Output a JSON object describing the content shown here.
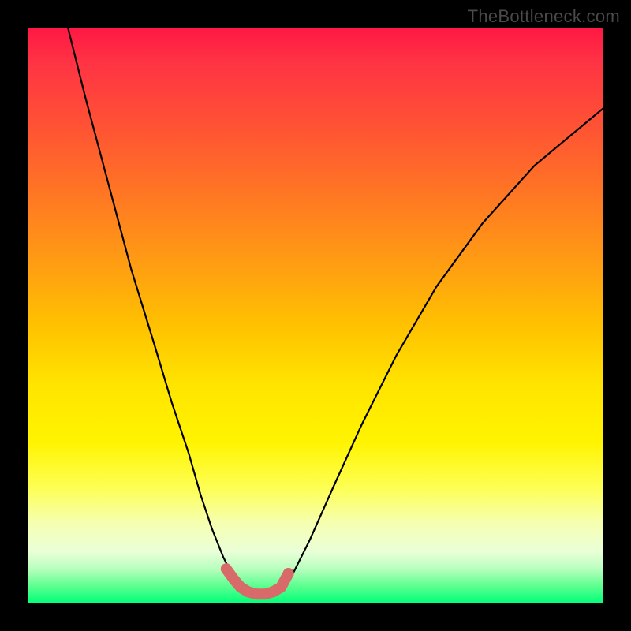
{
  "watermark": "TheBottleneck.com",
  "chart_data": {
    "type": "line",
    "title": "",
    "xlabel": "",
    "ylabel": "",
    "xlim": [
      0,
      100
    ],
    "ylim": [
      0,
      100
    ],
    "gradient_stops": [
      {
        "pct": 0,
        "color": "#ff1744"
      },
      {
        "pct": 6,
        "color": "#ff3344"
      },
      {
        "pct": 18,
        "color": "#ff5533"
      },
      {
        "pct": 30,
        "color": "#ff7a22"
      },
      {
        "pct": 42,
        "color": "#ffa011"
      },
      {
        "pct": 52,
        "color": "#ffc200"
      },
      {
        "pct": 62,
        "color": "#ffe400"
      },
      {
        "pct": 72,
        "color": "#fff400"
      },
      {
        "pct": 80,
        "color": "#fdff55"
      },
      {
        "pct": 86,
        "color": "#f6ffb0"
      },
      {
        "pct": 91,
        "color": "#eaffd8"
      },
      {
        "pct": 94,
        "color": "#b8ffbe"
      },
      {
        "pct": 97,
        "color": "#5cff8f"
      },
      {
        "pct": 100,
        "color": "#00ff7a"
      }
    ],
    "series": [
      {
        "name": "left-curve",
        "x": [
          7,
          10,
          14,
          18,
          22,
          25,
          28,
          30,
          32,
          34,
          36,
          37.5
        ],
        "y": [
          100,
          88,
          73,
          58,
          45,
          35,
          26,
          19,
          13,
          8,
          4,
          2
        ]
      },
      {
        "name": "right-curve",
        "x": [
          44,
          46,
          49,
          53,
          58,
          64,
          71,
          79,
          88,
          100
        ],
        "y": [
          2,
          5,
          11,
          20,
          31,
          43,
          55,
          66,
          76,
          86
        ]
      }
    ],
    "valley_markers": {
      "color": "#d96a6a",
      "points": [
        {
          "x": 34.5,
          "y": 6.0
        },
        {
          "x": 35.8,
          "y": 4.2
        },
        {
          "x": 37.0,
          "y": 2.8
        },
        {
          "x": 38.3,
          "y": 2.0
        },
        {
          "x": 39.8,
          "y": 1.6
        },
        {
          "x": 41.2,
          "y": 1.6
        },
        {
          "x": 42.6,
          "y": 2.0
        },
        {
          "x": 44.0,
          "y": 2.8
        },
        {
          "x": 45.3,
          "y": 5.2
        }
      ]
    }
  }
}
